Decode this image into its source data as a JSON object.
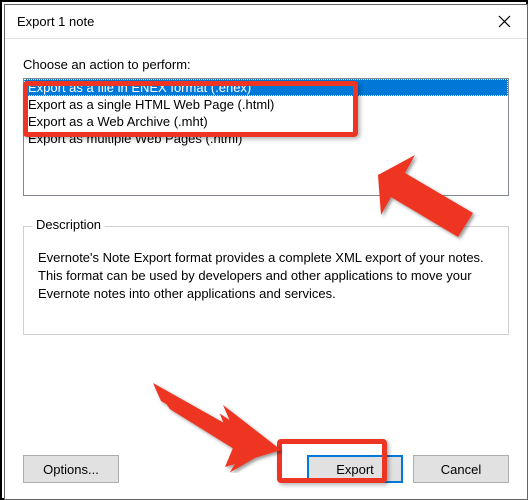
{
  "window": {
    "title": "Export 1 note"
  },
  "section": {
    "label": "Choose an action to perform:"
  },
  "options": {
    "item0": "Export as a file in ENEX format (.enex)",
    "item1": "Export as a single HTML Web Page (.html)",
    "item2": "Export as a Web Archive (.mht)",
    "item3": "Export as multiple Web Pages (.html)"
  },
  "description": {
    "label": "Description",
    "text": "Evernote's Note Export format provides a complete XML export of your notes. This format can be used by developers and other applications to move your Evernote notes into other applications and services."
  },
  "buttons": {
    "options": "Options...",
    "export": "Export",
    "cancel": "Cancel"
  }
}
